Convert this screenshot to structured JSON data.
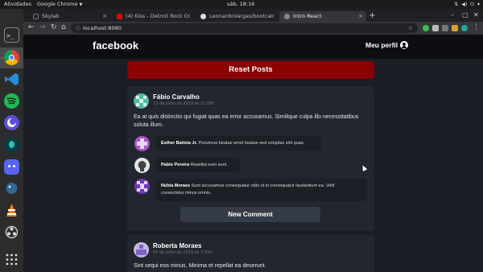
{
  "system_bar": {
    "activities": "Atividades",
    "app_name": "Google Chrome",
    "clock": "sáb, 18:16"
  },
  "browser": {
    "tabs": [
      {
        "label": "Skylab",
        "active": false
      },
      {
        "label": "(4) Kiss - Detroit Rock C",
        "active": false
      },
      {
        "label": "LeonardoVargas/bootca",
        "active": false
      },
      {
        "label": "Intro React",
        "active": true
      }
    ],
    "url": "localhost:8080"
  },
  "site": {
    "logo": "facebook",
    "profile_label": "Meu perfil",
    "reset_button": "Reset Posts"
  },
  "posts": [
    {
      "author": "Fábio Carvalho",
      "date": "13 de julho de 2019 às 21:08h",
      "text_line1": "Ea at quis distinctio qui fugiat quas ea error accusamus. Similique culpa illo necessitatibus",
      "text_line2": "soluta illum.",
      "comments": [
        {
          "author": "Esther Batista Jr.",
          "text": "Possimus beatae amet beatae sed voluptas sint quas."
        },
        {
          "author": "Pablo Pereira",
          "text": "Repellat eum sunt."
        },
        {
          "author": "Núbia Moraes",
          "text_line1": "Sunt accusamus consequatur odio ut in consequatur laudantium ea. Velit",
          "text_line2": "consectetur minus omnis."
        }
      ],
      "new_comment_button": "New Comment"
    },
    {
      "author": "Roberta Moraes",
      "date": "05 de julho de 2019 às 7:15h",
      "text_line1": "Sint sequi eos minus. Minima et repellat ea deserunt."
    }
  ],
  "colors": {
    "header_bg": "#0c0e12",
    "page_bg": "#1a1d24",
    "card_bg": "#22262e",
    "reset_red": "#8b0000",
    "new_comment_bg": "#353b47"
  }
}
